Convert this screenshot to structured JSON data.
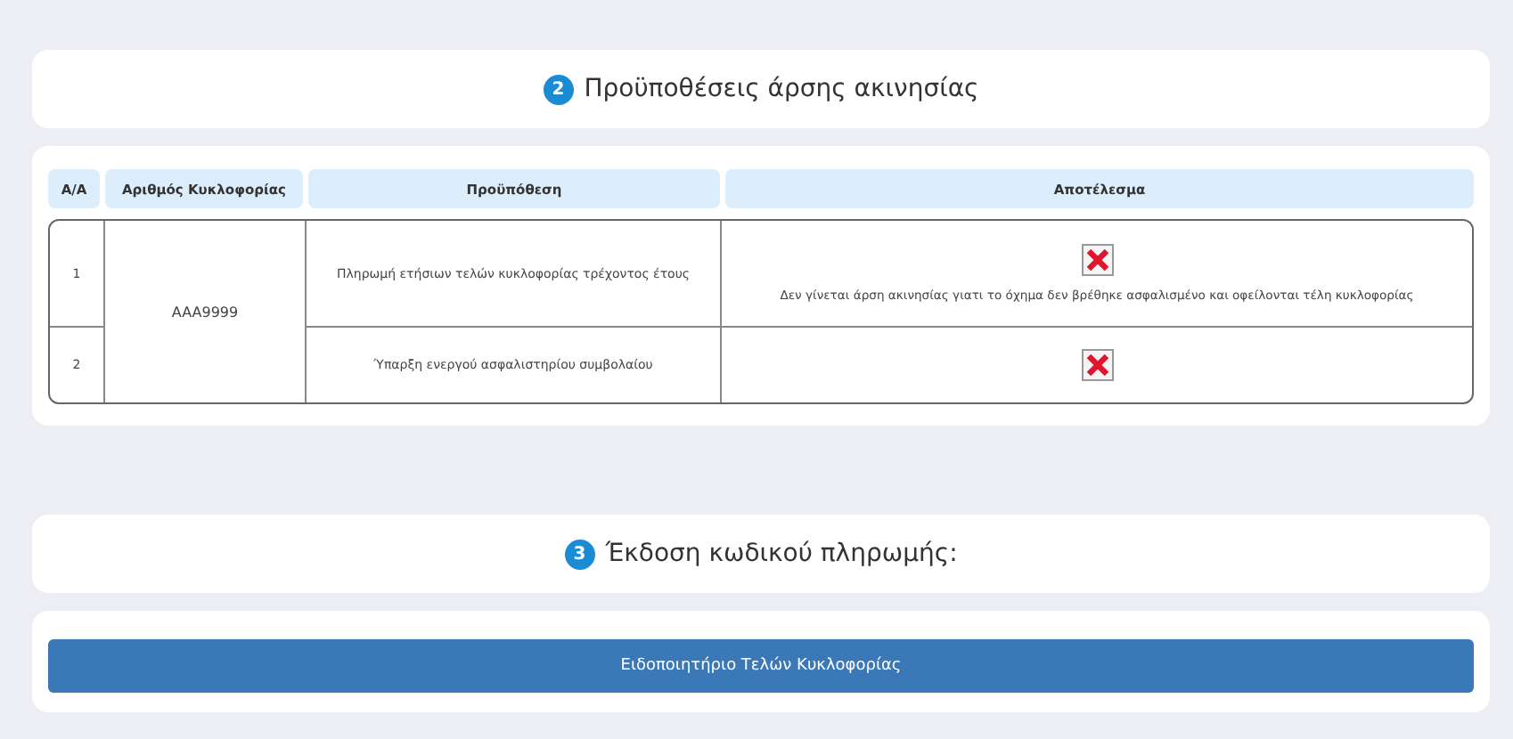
{
  "sections": [
    {
      "step": "2",
      "title": "Προϋποθέσεις άρσης ακινησίας"
    },
    {
      "step": "3",
      "title": "Έκδοση κωδικού πληρωμής:"
    }
  ],
  "table": {
    "columns": [
      "Α/Α",
      "Αριθμός Κυκλοφορίας",
      "Προϋπόθεση",
      "Αποτέλεσμα"
    ],
    "registration": "AAA9999",
    "rows": [
      {
        "number": "1",
        "condition": "Πληρωμή ετήσιων τελών κυκλοφορίας τρέχοντος έτους",
        "passed": false,
        "message": "Δεν γίνεται άρση ακινησίας γιατι το όχημα δεν βρέθηκε ασφαλισμένο και οφείλονται τέλη κυκλοφορίας"
      },
      {
        "number": "2",
        "condition": "Ύπαρξη ενεργού ασφαλιστηρίου συμβολαίου",
        "passed": false
      }
    ]
  },
  "button": {
    "label": "Ειδοποιητήριο Τελών Κυκλοφορίας"
  }
}
